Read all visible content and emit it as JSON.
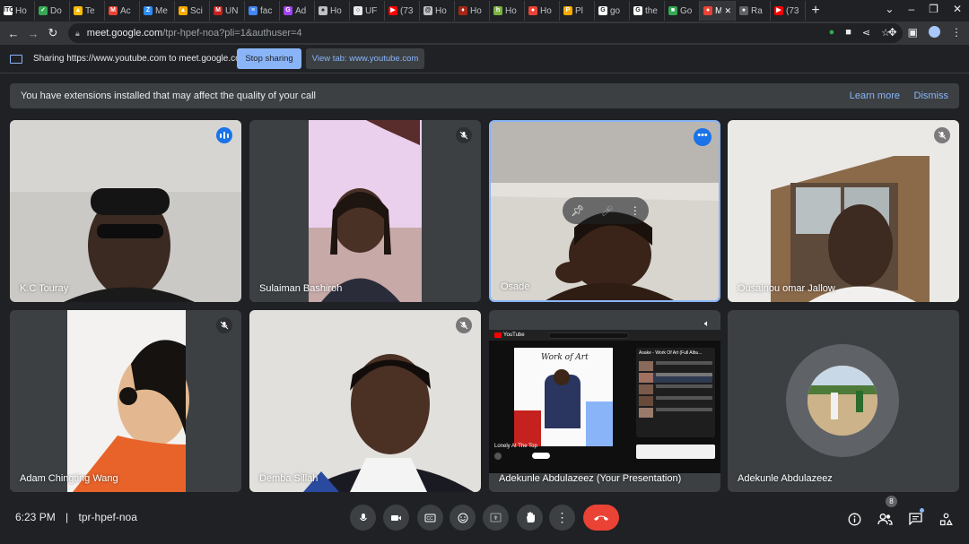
{
  "browser": {
    "tabs": [
      {
        "label": "Ho",
        "icon": "itc-favicon",
        "color": "#ffffff",
        "glyph": "ITC"
      },
      {
        "label": "Do",
        "icon": "check-favicon",
        "color": "#34a853",
        "glyph": "✓"
      },
      {
        "label": "Te",
        "icon": "drive-favicon",
        "color": "#fbbc04",
        "glyph": "▲"
      },
      {
        "label": "Ac",
        "icon": "gmail-favicon",
        "color": "#ea4335",
        "glyph": "M"
      },
      {
        "label": "Me",
        "icon": "zoom-favicon",
        "color": "#2d8cff",
        "glyph": "Z"
      },
      {
        "label": "Sci",
        "icon": "triangle-favicon",
        "color": "#f9ab00",
        "glyph": "▲"
      },
      {
        "label": "UN",
        "icon": "unity-favicon",
        "color": "#c5221f",
        "glyph": "M"
      },
      {
        "label": "fac",
        "icon": "docs-favicon",
        "color": "#4285f4",
        "glyph": "≡"
      },
      {
        "label": "Ad",
        "icon": "g-favicon",
        "color": "#a142f4",
        "glyph": "G"
      },
      {
        "label": "Ho",
        "icon": "mushroom-favicon",
        "color": "#bdc1c6",
        "glyph": "♠"
      },
      {
        "label": "UF",
        "icon": "circle-favicon",
        "color": "#e8eaed",
        "glyph": "○"
      },
      {
        "label": "(73",
        "icon": "youtube-favicon",
        "color": "#ff0000",
        "glyph": "▶"
      },
      {
        "label": "Ho",
        "icon": "swirl-favicon",
        "color": "#bdc1c6",
        "glyph": "@"
      },
      {
        "label": "Ho",
        "icon": "red-leaf-favicon",
        "color": "#a52714",
        "glyph": "♦"
      },
      {
        "label": "Ho",
        "icon": "h-favicon",
        "color": "#7cb342",
        "glyph": "h"
      },
      {
        "label": "Ho",
        "icon": "record-favicon",
        "color": "#ea4335",
        "glyph": "●"
      },
      {
        "label": "Pl",
        "icon": "p-favicon",
        "color": "#f9ab00",
        "glyph": "P"
      },
      {
        "label": "go",
        "icon": "google-favicon",
        "color": "#ffffff",
        "glyph": "G"
      },
      {
        "label": "the",
        "icon": "google-favicon",
        "color": "#ffffff",
        "glyph": "G"
      },
      {
        "label": "Go",
        "icon": "classroom-favicon",
        "color": "#34a853",
        "glyph": "■"
      },
      {
        "label": "M",
        "icon": "meet-favicon",
        "color": "#ea4335",
        "glyph": "●",
        "active": true
      },
      {
        "label": "Ra",
        "icon": "dark-favicon",
        "color": "#5f6368",
        "glyph": "●"
      },
      {
        "label": "(73",
        "icon": "youtube-favicon",
        "color": "#ff0000",
        "glyph": "▶"
      }
    ],
    "url_domain": "meet.google.com",
    "url_path": "/tpr-hpef-noa?pli=1&authuser=4"
  },
  "share_bar": {
    "text": "Sharing https://www.youtube.com to meet.google.com",
    "stop_label": "Stop sharing",
    "view_label": "View tab: www.youtube.com"
  },
  "notice": {
    "text": "You have extensions installed that may affect the quality of your call",
    "learn_more": "Learn more",
    "dismiss": "Dismiss"
  },
  "participants": [
    {
      "name": "K.C Touray",
      "status": "speaking",
      "bg": "#c9c8c4",
      "skin": "#3b2a21"
    },
    {
      "name": "Sulaiman Bashiroh",
      "status": "muted",
      "bg": "#e8c9e8",
      "skin": "#4a3126"
    },
    {
      "name": "Osade",
      "status": "pinned",
      "bg": "#d9d6d0",
      "skin": "#3a2419"
    },
    {
      "name": "Ousainou omar Jallow",
      "status": "muted",
      "bg": "#e9e7e4",
      "skin": "#3d2a20"
    },
    {
      "name": "Adam Chingting Wang",
      "status": "muted",
      "bg": "#f3f2f0",
      "skin": "#e3b890"
    },
    {
      "name": "Demba Sillah",
      "status": "muted",
      "bg": "#e4e2df",
      "skin": "#4b3024"
    },
    {
      "name": "Adekunle Abdulazeez (Your Presentation)",
      "status": "presentation",
      "bg": "#0f0f0f",
      "skin": "#ffffff"
    },
    {
      "name": "Adekunle Abdulazeez",
      "status": "avatar",
      "bg": "#3c4043",
      "skin": "#d0b48a"
    }
  ],
  "youtube_preview": {
    "logo": "YouTube",
    "video_title": "Lonely At The Top",
    "album_art_text": "Work of Art",
    "playlist_title": "Asake - Work Of Art (Full Albu..."
  },
  "bottom": {
    "time": "6:23 PM",
    "separator": "|",
    "meeting_code": "tpr-hpef-noa",
    "people_count": "8"
  }
}
